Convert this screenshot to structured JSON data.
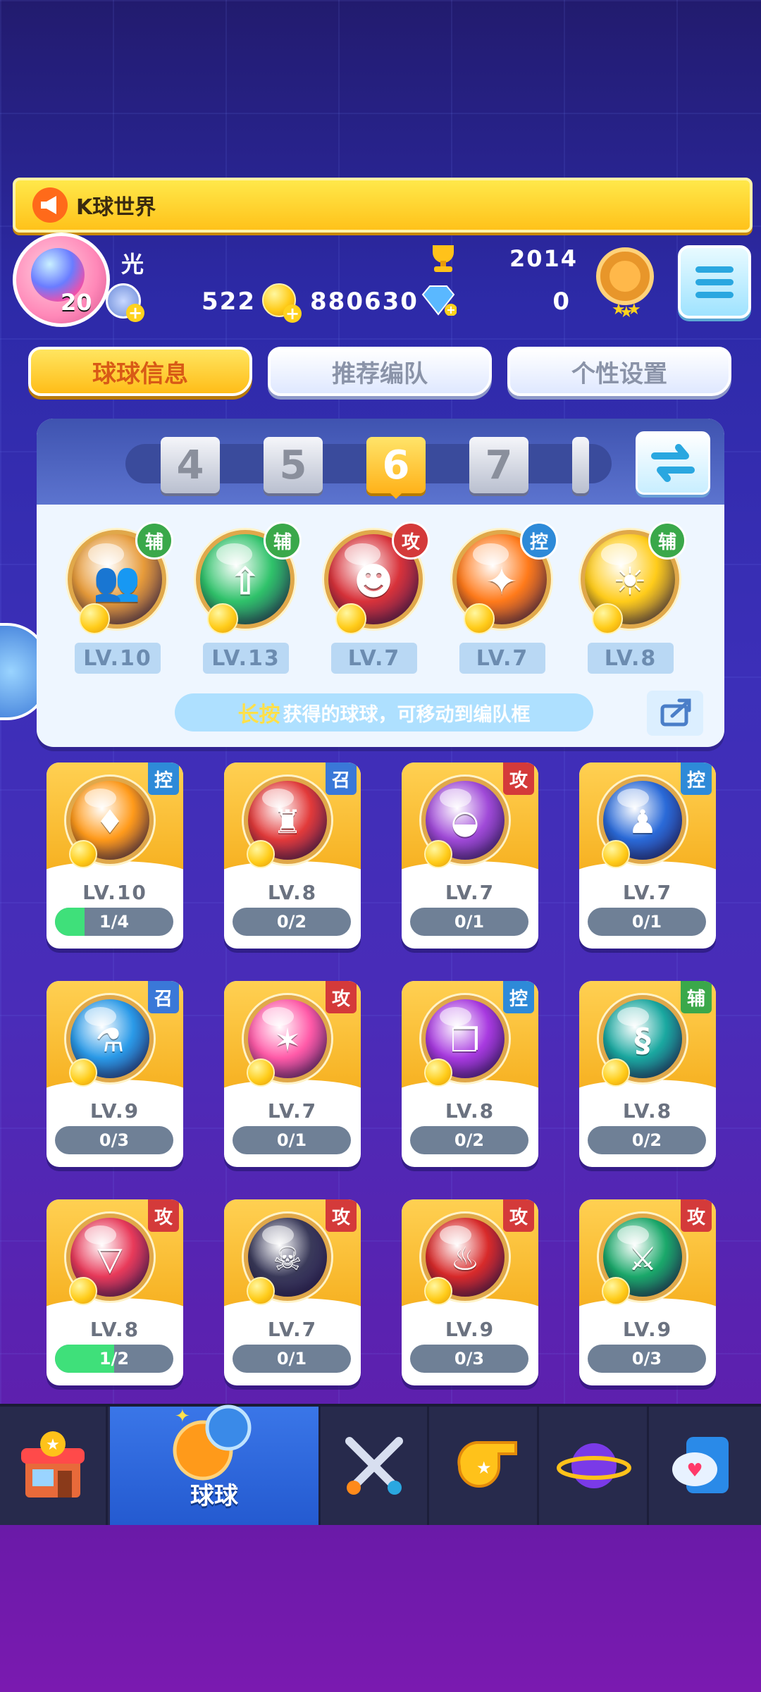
{
  "banner": {
    "text": "K球世界"
  },
  "player": {
    "name": "光",
    "level": "20",
    "trophies": "2014",
    "coins": "522",
    "gold": "880630",
    "gems": "0"
  },
  "tabs": [
    {
      "label": "球球信息",
      "active": true
    },
    {
      "label": "推荐编队",
      "active": false
    },
    {
      "label": "个性设置",
      "active": false
    }
  ],
  "team": {
    "slots": [
      "4",
      "5",
      "6",
      "7"
    ],
    "active_slot": "6",
    "balls": [
      {
        "tag": "辅",
        "level": "LV.10",
        "icon": "twins-icon",
        "color": "#e79b3a"
      },
      {
        "tag": "辅",
        "level": "LV.13",
        "icon": "arrow-up-icon",
        "color": "#2fc26a"
      },
      {
        "tag": "攻",
        "level": "LV.7",
        "icon": "opera-mask-icon",
        "color": "#d8323a"
      },
      {
        "tag": "控",
        "level": "LV.7",
        "icon": "star-burst-icon",
        "color": "#ff7a1a"
      },
      {
        "tag": "辅",
        "level": "LV.8",
        "icon": "sun-icon",
        "color": "#ffcc1a"
      }
    ],
    "tip_highlight": "长按",
    "tip_text": "获得的球球，可移动到编队框"
  },
  "cards": [
    {
      "tag": "控",
      "level": "LV.10",
      "progress": "1/4",
      "fill": 0.25,
      "icon": "wings-icon",
      "color": "#ff9a1a"
    },
    {
      "tag": "召",
      "level": "LV.8",
      "progress": "0/2",
      "fill": 0,
      "icon": "tower-icon",
      "color": "#e23a3a"
    },
    {
      "tag": "攻",
      "level": "LV.7",
      "progress": "0/1",
      "fill": 0,
      "icon": "mask-icon",
      "color": "#a04ad8"
    },
    {
      "tag": "控",
      "level": "LV.7",
      "progress": "0/1",
      "fill": 0,
      "icon": "hero-icon",
      "color": "#2a6ad8"
    },
    {
      "tag": "召",
      "level": "LV.9",
      "progress": "0/3",
      "fill": 0,
      "icon": "potion-icon",
      "color": "#2a9ae8"
    },
    {
      "tag": "攻",
      "level": "LV.7",
      "progress": "0/1",
      "fill": 0,
      "icon": "crystal-icon",
      "color": "#ff5aa8"
    },
    {
      "tag": "控",
      "level": "LV.8",
      "progress": "0/2",
      "fill": 0,
      "icon": "book-icon",
      "color": "#a83ae0"
    },
    {
      "tag": "辅",
      "level": "LV.8",
      "progress": "0/2",
      "fill": 0,
      "icon": "dragon-icon",
      "color": "#1aa8a0"
    },
    {
      "tag": "攻",
      "level": "LV.8",
      "progress": "1/2",
      "fill": 0.5,
      "icon": "prism-icon",
      "color": "#e83a5a"
    },
    {
      "tag": "攻",
      "level": "LV.7",
      "progress": "0/1",
      "fill": 0,
      "icon": "venom-icon",
      "color": "#3a3a5a"
    },
    {
      "tag": "攻",
      "level": "LV.9",
      "progress": "0/3",
      "fill": 0,
      "icon": "phoenix-icon",
      "color": "#d82a2a"
    },
    {
      "tag": "攻",
      "level": "LV.9",
      "progress": "0/3",
      "fill": 0,
      "icon": "bow-icon",
      "color": "#1aa86a"
    }
  ],
  "nav": [
    {
      "name": "shop",
      "icon": "shop-icon"
    },
    {
      "name": "balls",
      "icon": "balls-icon",
      "label": "球球",
      "active": true
    },
    {
      "name": "battle",
      "icon": "swords-icon"
    },
    {
      "name": "whistle",
      "icon": "whistle-icon"
    },
    {
      "name": "planet",
      "icon": "planet-icon"
    },
    {
      "name": "social",
      "icon": "chat-heart-icon"
    }
  ],
  "colors": {
    "accent": "#ffc21a",
    "tag_assist": "#3aa84a",
    "tag_attack": "#d43a3a",
    "tag_control": "#2e8ad8",
    "tag_summon": "#3a78d8"
  }
}
